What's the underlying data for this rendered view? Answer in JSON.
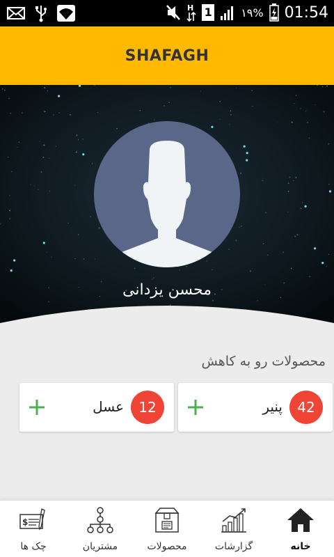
{
  "status_bar": {
    "battery_percent": "۱۹%",
    "time": "01:54",
    "sim_label": "1",
    "icons": [
      "mail-icon",
      "usb-icon",
      "wifi-icon",
      "mute-icon",
      "data-arrows-icon",
      "sim-icon",
      "signal-icon",
      "battery-icon"
    ]
  },
  "app_bar": {
    "title": "SHAFAGH",
    "color": "#ffb900"
  },
  "profile": {
    "name": "محسن یزدانی"
  },
  "section": {
    "title": "محصولات رو به کاهش"
  },
  "products": [
    {
      "name": "پنیر",
      "count": "42"
    },
    {
      "name": "عسل",
      "count": "12"
    }
  ],
  "nav": {
    "items": [
      {
        "label": "خانه",
        "icon": "home-icon",
        "active": true
      },
      {
        "label": "گزارشات",
        "icon": "chart-icon",
        "active": false
      },
      {
        "label": "محصولات",
        "icon": "box-icon",
        "active": false
      },
      {
        "label": "مشتریان",
        "icon": "org-tree-icon",
        "active": false
      },
      {
        "label": "چک ها",
        "icon": "check-icon",
        "active": false
      }
    ]
  },
  "colors": {
    "badge": "#f04437",
    "plus": "#4caf50",
    "accent": "#ffb900"
  }
}
